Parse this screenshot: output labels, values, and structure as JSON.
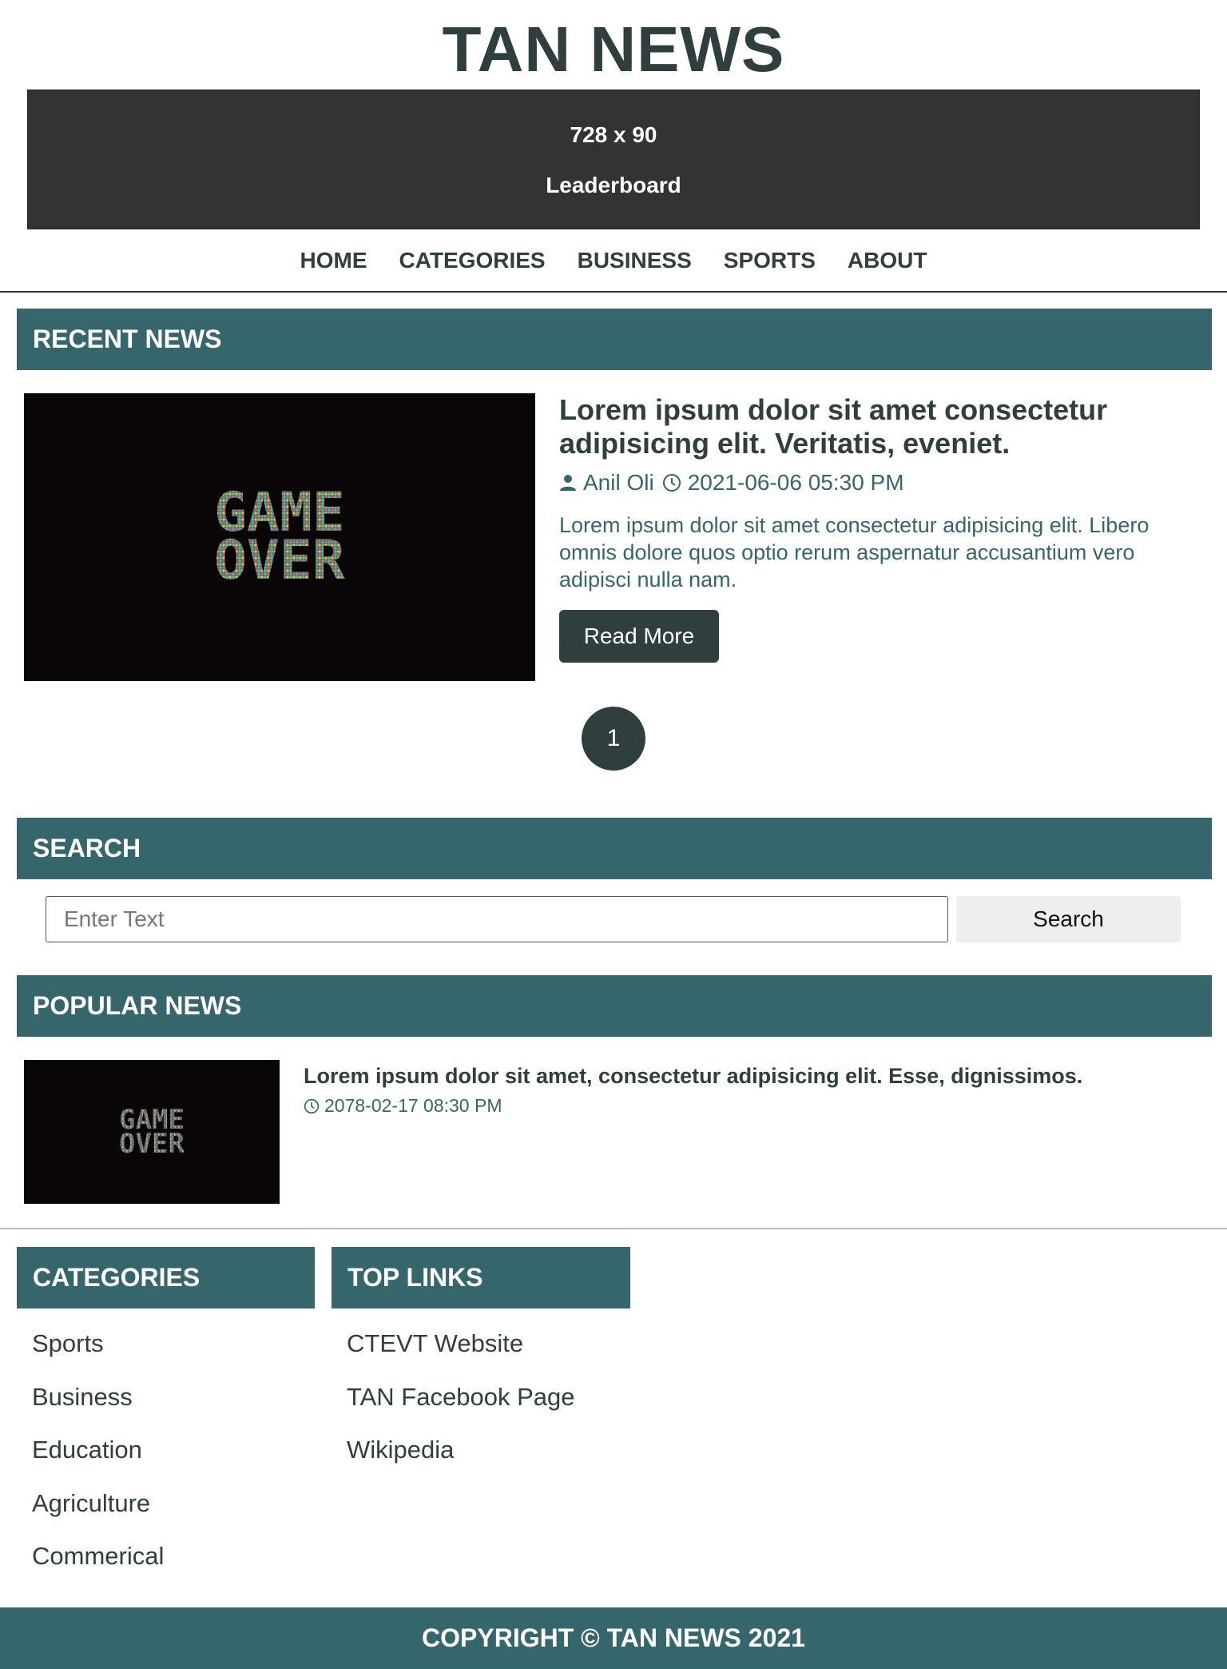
{
  "site": {
    "title": "TAN NEWS"
  },
  "ad": {
    "size": "728 x 90",
    "label": "Leaderboard"
  },
  "nav": [
    "HOME",
    "CATEGORIES",
    "BUSINESS",
    "SPORTS",
    "ABOUT"
  ],
  "recent": {
    "heading": "RECENT NEWS",
    "article": {
      "title": "Lorem ipsum dolor sit amet consectetur adipisicing elit. Veritatis, eveniet.",
      "author": "Anil Oli",
      "date": "2021-06-06 05:30 PM",
      "excerpt": "Lorem ipsum dolor sit amet consectetur adipisicing elit. Libero omnis dolore quos optio rerum aspernatur accusantium vero adipisci nulla nam.",
      "read_more": "Read More",
      "image_text": [
        "GAME",
        "OVER"
      ]
    },
    "page": "1"
  },
  "search": {
    "heading": "SEARCH",
    "placeholder": "Enter Text",
    "button": "Search"
  },
  "popular": {
    "heading": "POPULAR NEWS",
    "article": {
      "title": "Lorem ipsum dolor sit amet, consectetur adipisicing elit. Esse, dignissimos.",
      "date": "2078-02-17 08:30 PM",
      "image_text": [
        "GAME",
        "OVER"
      ]
    }
  },
  "footer": {
    "categories_heading": "CATEGORIES",
    "categories": [
      "Sports",
      "Business",
      "Education",
      "Agriculture",
      "Commerical"
    ],
    "links_heading": "TOP LINKS",
    "links": [
      "CTEVT Website",
      "TAN Facebook Page",
      "Wikipedia"
    ],
    "copyright": "COPYRIGHT © TAN NEWS 2021"
  },
  "colors": {
    "primary": "#35666c",
    "dark": "#2f3f3f",
    "ad_bg": "#333333"
  },
  "icons": {
    "author": "user-icon",
    "date": "clock-icon"
  }
}
